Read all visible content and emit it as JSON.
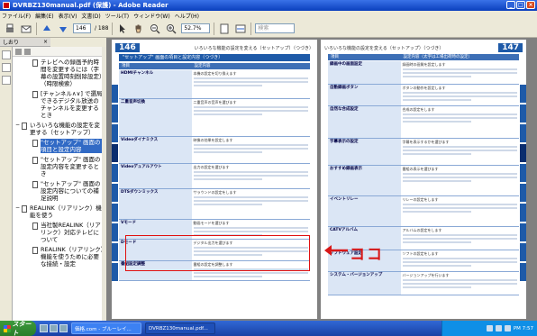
{
  "window": {
    "title": "DVRBZ130manual.pdf (保護) - Adobe Reader"
  },
  "menu": [
    "ファイル(F)",
    "編集(E)",
    "表示(V)",
    "文書(D)",
    "ツール(T)",
    "ウィンドウ(W)",
    "ヘルプ(H)"
  ],
  "toolbar": {
    "page_current": "146",
    "page_total": "/ 188",
    "zoom": "52.7%",
    "search_placeholder": "検索"
  },
  "panel": {
    "title": "しおり"
  },
  "bookmarks": [
    {
      "label": "テレビへの録画予約時間を変更するには（字幕の設置時刻削除設定）（時限検索）",
      "selected": false,
      "indent": true
    },
    {
      "label": "[チャンネル∧∨] で選局できるデジタル放送のチャンネルを変更するとき",
      "selected": false,
      "indent": true
    },
    {
      "label": "いろいろな機能の設定を変更する（セットアップ）",
      "selected": false,
      "indent": false
    },
    {
      "label": "\"セットアップ\" 画面の項目と設定内容",
      "selected": true,
      "indent": true
    },
    {
      "label": "\"セットアップ\" 画面の設定内容を変更するとき",
      "selected": false,
      "indent": true
    },
    {
      "label": "\"セットアップ\" 画面の設定内容についての補足説明",
      "selected": false,
      "indent": true
    },
    {
      "label": "REALINK（リアリンク）機能を使う",
      "selected": false,
      "indent": false
    },
    {
      "label": "当社製REALINK（リアリンク）対応テレビについて",
      "selected": false,
      "indent": true
    },
    {
      "label": "REALINK（リアリンク）機能を使うために必要な接続・設定",
      "selected": false,
      "indent": true
    }
  ],
  "page_left": {
    "number": "146",
    "header": "いろいろな機能の設定を変える（セットアップ）（つづき）",
    "section": "\"セットアップ\" 画面の項目と設定内容（つづき）",
    "col_headers": [
      "項目",
      "設定内容"
    ],
    "rows": [
      {
        "title": "HDMIチャンネル",
        "desc": "本機の設定を切り換えます"
      },
      {
        "title": "二重音声切換",
        "desc": "二重音声の音声を選びます"
      },
      {
        "title": "Videoダイナミクス",
        "desc": "映像の効果を設定します"
      },
      {
        "title": "Videoデュアルアウト",
        "desc": "出力の設定を選びます"
      },
      {
        "title": "DTSダウンミックス",
        "desc": "サラウンドの設定をします"
      },
      {
        "title": "Vモード",
        "desc": "動画モードを選びます"
      },
      {
        "title": "Dモード",
        "desc": "デジタル出力を選びます"
      },
      {
        "title": "番組設定調整",
        "desc": "番組の設定を調整します"
      }
    ]
  },
  "page_right": {
    "number": "147",
    "header": "いろいろな機能の設定を変える（セットアップ）（つづき）",
    "col_headers": [
      "項目",
      "設定内容（太字は工場出荷時の設定）"
    ],
    "rows": [
      {
        "title": "録画中の画面設定",
        "desc": "録画時の画質を設定します"
      },
      {
        "title": "自動録画ボタン",
        "desc": "ボタンの動作を設定します"
      },
      {
        "title": "自然な合成設定",
        "desc": "合成の設定をします"
      },
      {
        "title": "字幕表示の設定",
        "desc": "字幕を表示するかを選びます"
      },
      {
        "title": "おすすめ録画表示",
        "desc": "番組の表示を選びます"
      },
      {
        "title": "イベントリレー",
        "desc": "リレーの設定をします"
      },
      {
        "title": "CATVアルバム",
        "desc": "アルバムの設定をします"
      },
      {
        "title": "ソフトウェア設定",
        "desc": "ソフトの設定をします"
      },
      {
        "title": "システム・バージョンアップ",
        "desc": "バージョンアップを行います"
      }
    ]
  },
  "annotation": {
    "text": "ココ"
  },
  "taskbar": {
    "start": "スタート",
    "tasks": [
      "価格.com - ブルーレイ...",
      "DVRBZ130manual.pdf..."
    ],
    "clock": "PM 7:57"
  }
}
